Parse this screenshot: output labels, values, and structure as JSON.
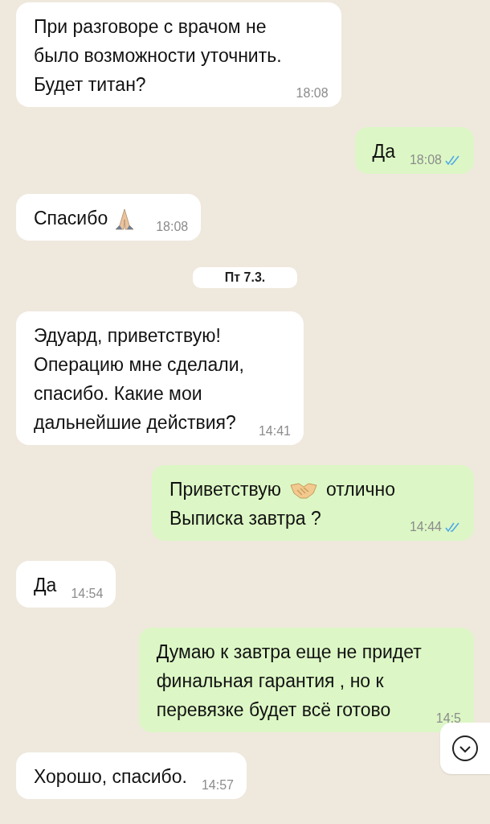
{
  "messages": [
    {
      "kind": "incoming",
      "segments": [
        {
          "kind": "text",
          "text": "При разговоре с врачом не\nбыло возможности уточнить.\nБудет титан?"
        }
      ],
      "time": "18:08"
    },
    {
      "kind": "outgoing",
      "segments": [
        {
          "kind": "text",
          "text": "Да"
        }
      ],
      "time": "18:08",
      "read": true
    },
    {
      "kind": "incoming",
      "segments": [
        {
          "kind": "text",
          "text": "Спасибо"
        },
        {
          "kind": "pray"
        }
      ],
      "time": "18:08"
    },
    {
      "kind": "date",
      "text": "Пт 7.3."
    },
    {
      "kind": "incoming",
      "segments": [
        {
          "kind": "text",
          "text": "Эдуард, приветствую!\nОперацию мне сделали,\nспасибо. Какие мои\nдальнейшие действия?"
        }
      ],
      "time": "14:41"
    },
    {
      "kind": "outgoing",
      "segments": [
        {
          "kind": "text",
          "text": "Приветствую"
        },
        {
          "kind": "handshake"
        },
        {
          "kind": "text",
          "text": "отлично"
        },
        {
          "kind": "break"
        },
        {
          "kind": "text",
          "text": "Выписка завтра ?"
        }
      ],
      "time": "14:44",
      "read": true
    },
    {
      "kind": "incoming",
      "segments": [
        {
          "kind": "text",
          "text": "Да"
        }
      ],
      "time": "14:54"
    },
    {
      "kind": "outgoing",
      "segments": [
        {
          "kind": "text",
          "text": "Думаю к завтра еще не придет\nфинальная гарантия , но к\nперевязке будет всё готово"
        }
      ],
      "time": "14:5"
    },
    {
      "kind": "incoming",
      "segments": [
        {
          "kind": "text",
          "text": "Хорошо, спасибо."
        }
      ],
      "time": "14:57"
    }
  ]
}
